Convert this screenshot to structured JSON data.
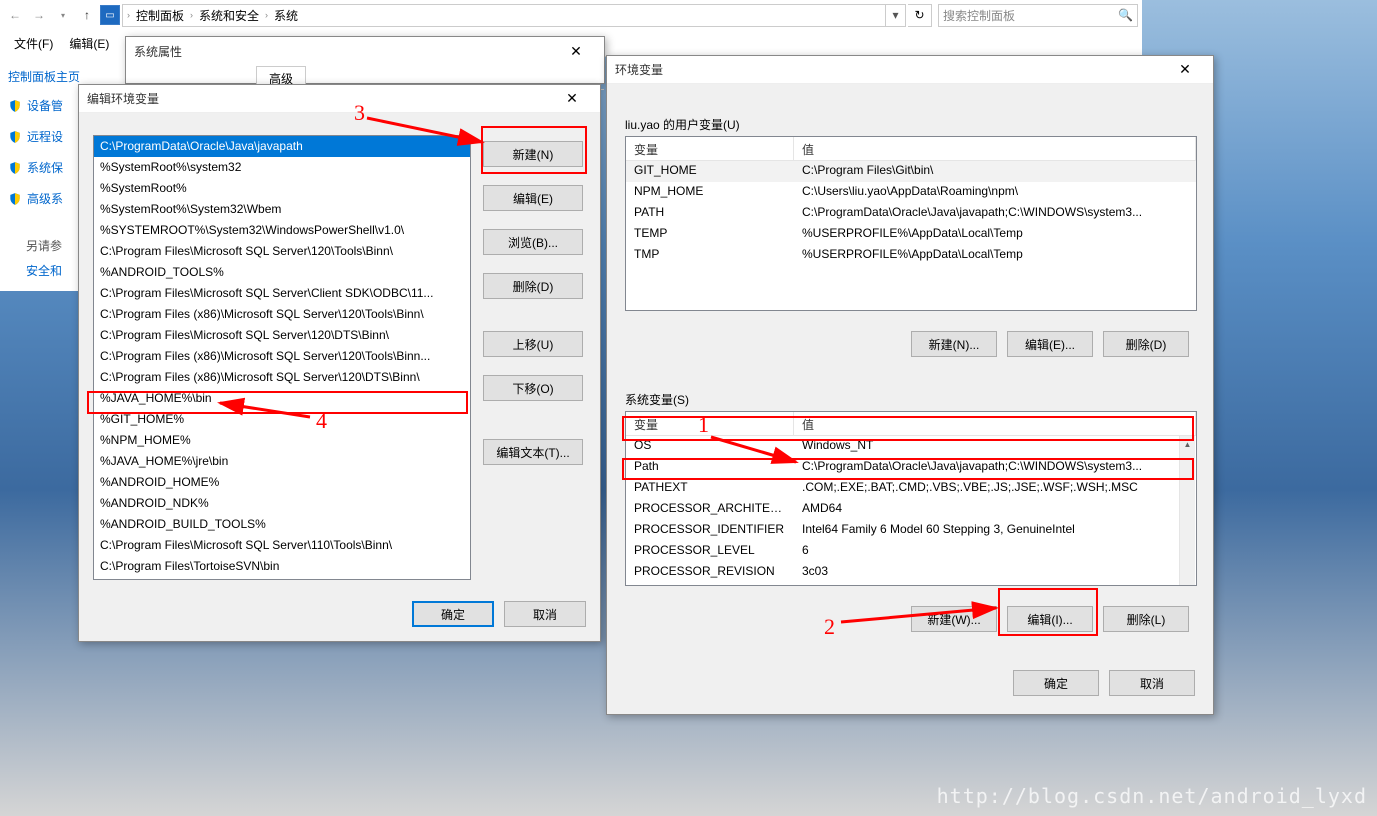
{
  "explorer": {
    "breadcrumb": [
      "控制面板",
      "系统和安全",
      "系统"
    ],
    "search_placeholder": "搜索控制面板",
    "menu": {
      "file": "文件(F)",
      "edit": "编辑(E)"
    },
    "sidebar": {
      "title": "控制面板主页",
      "items": [
        "设备管",
        "远程设",
        "系统保",
        "高级系"
      ],
      "seealso": "另请参",
      "security": "安全和"
    }
  },
  "sysprops": {
    "title": "系统属性",
    "active_tab": "高级"
  },
  "editenv": {
    "title": "编辑环境变量",
    "items": [
      "C:\\ProgramData\\Oracle\\Java\\javapath",
      "%SystemRoot%\\system32",
      "%SystemRoot%",
      "%SystemRoot%\\System32\\Wbem",
      "%SYSTEMROOT%\\System32\\WindowsPowerShell\\v1.0\\",
      "C:\\Program Files\\Microsoft SQL Server\\120\\Tools\\Binn\\",
      "%ANDROID_TOOLS%",
      "C:\\Program Files\\Microsoft SQL Server\\Client SDK\\ODBC\\11...",
      "C:\\Program Files (x86)\\Microsoft SQL Server\\120\\Tools\\Binn\\",
      "C:\\Program Files\\Microsoft SQL Server\\120\\DTS\\Binn\\",
      "C:\\Program Files (x86)\\Microsoft SQL Server\\120\\Tools\\Binn...",
      "C:\\Program Files (x86)\\Microsoft SQL Server\\120\\DTS\\Binn\\",
      "%JAVA_HOME%\\bin",
      "%GIT_HOME%",
      "%NPM_HOME%",
      "%JAVA_HOME%\\jre\\bin",
      "%ANDROID_HOME%",
      "%ANDROID_NDK%",
      "%ANDROID_BUILD_TOOLS%",
      "C:\\Program Files\\Microsoft SQL Server\\110\\Tools\\Binn\\",
      "C:\\Program Files\\TortoiseSVN\\bin"
    ],
    "buttons": {
      "new": "新建(N)",
      "edit": "编辑(E)",
      "browse": "浏览(B)...",
      "delete": "删除(D)",
      "up": "上移(U)",
      "down": "下移(O)",
      "edittext": "编辑文本(T)...",
      "ok": "确定",
      "cancel": "取消"
    }
  },
  "envvars": {
    "title": "环境变量",
    "user_section": "liu.yao 的用户变量(U)",
    "system_section": "系统变量(S)",
    "col_var": "变量",
    "col_val": "值",
    "user_rows": [
      {
        "var": "GIT_HOME",
        "val": "C:\\Program Files\\Git\\bin\\"
      },
      {
        "var": "NPM_HOME",
        "val": "C:\\Users\\liu.yao\\AppData\\Roaming\\npm\\"
      },
      {
        "var": "PATH",
        "val": "C:\\ProgramData\\Oracle\\Java\\javapath;C:\\WINDOWS\\system3..."
      },
      {
        "var": "TEMP",
        "val": "%USERPROFILE%\\AppData\\Local\\Temp"
      },
      {
        "var": "TMP",
        "val": "%USERPROFILE%\\AppData\\Local\\Temp"
      }
    ],
    "sys_rows": [
      {
        "var": "OS",
        "val": "Windows_NT"
      },
      {
        "var": "Path",
        "val": "C:\\ProgramData\\Oracle\\Java\\javapath;C:\\WINDOWS\\system3..."
      },
      {
        "var": "PATHEXT",
        "val": ".COM;.EXE;.BAT;.CMD;.VBS;.VBE;.JS;.JSE;.WSF;.WSH;.MSC"
      },
      {
        "var": "PROCESSOR_ARCHITECT...",
        "val": "AMD64"
      },
      {
        "var": "PROCESSOR_IDENTIFIER",
        "val": "Intel64 Family 6 Model 60 Stepping 3, GenuineIntel"
      },
      {
        "var": "PROCESSOR_LEVEL",
        "val": "6"
      },
      {
        "var": "PROCESSOR_REVISION",
        "val": "3c03"
      }
    ],
    "buttons": {
      "new_u": "新建(N)...",
      "edit_u": "编辑(E)...",
      "del_u": "删除(D)",
      "new_s": "新建(W)...",
      "edit_s": "编辑(I)...",
      "del_s": "删除(L)",
      "ok": "确定",
      "cancel": "取消"
    }
  },
  "annotations": {
    "n1": "1",
    "n2": "2",
    "n3": "3",
    "n4": "4"
  },
  "watermark": "http://blog.csdn.net/android_lyxd"
}
